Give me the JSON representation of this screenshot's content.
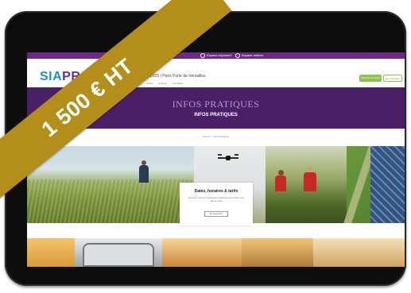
{
  "header": {
    "logo_text": "SIA",
    "logo_accent": "PRO",
    "site_subtitle": "2025 | Paris Porte de Versailles",
    "top_links": [
      "Espace exposant",
      "Espace visiteur"
    ],
    "nav_items": [
      "Le salon",
      "Visiter",
      "Exposer",
      "Actualités"
    ],
    "cta_primary": "Réserver un stand",
    "cta_secondary": "Se connecter"
  },
  "hero": {
    "title": "INFOS PRATIQUES",
    "subtitle": "INFOS PRATIQUES"
  },
  "breadcrumb": "Accueil  >  Infos Pratiques",
  "card": {
    "title": "Dates, horaires & tarifs",
    "text": "Retrouvez toutes les informations pratiques pour préparer votre visite du salon.",
    "button": "En savoir plus"
  },
  "ribbon": {
    "label": "1 500 € HT",
    "color": "#b38e1a"
  },
  "colors": {
    "brand_purple": "#4a1f68",
    "brand_blue": "#1e8fc0",
    "cta_green": "#8bc34a"
  }
}
